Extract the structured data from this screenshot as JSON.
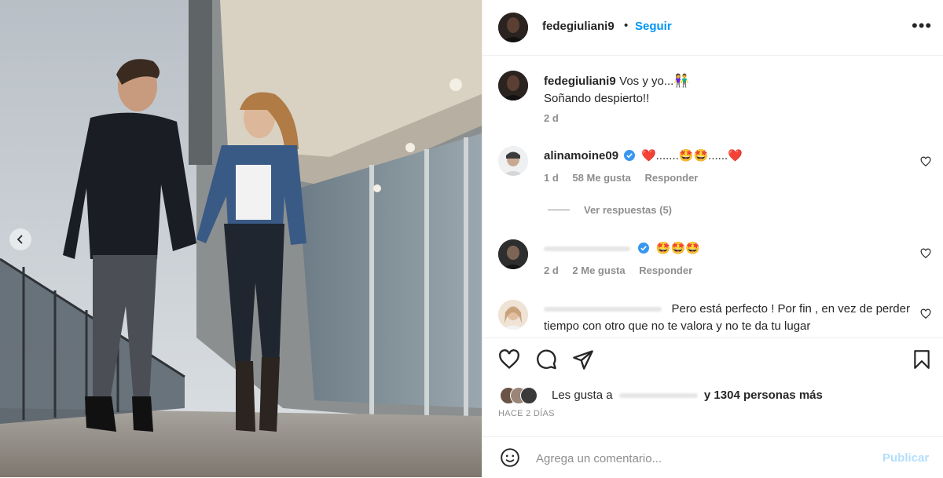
{
  "post": {
    "author": "fedegiuliani9",
    "follow_label": "Seguir",
    "separator": "•",
    "more_label": "•••"
  },
  "caption": {
    "user": "fedegiuliani9",
    "line1": "Vos y yo...",
    "emoji": "👫",
    "line2": "Soñando despierto!!",
    "time": "2 d"
  },
  "comments": [
    {
      "user": "alinamoine09",
      "verified": true,
      "text": "❤️.......🤩🤩......❤️",
      "time": "1 d",
      "likes": "58 Me gusta",
      "reply": "Responder",
      "view_replies": "Ver respuestas (5)"
    },
    {
      "user": "",
      "verified": true,
      "text": "🤩🤩🤩",
      "time": "2 d",
      "likes": "2 Me gusta",
      "reply": "Responder"
    },
    {
      "user": "",
      "text": "Pero está perfecto ! Por fin , en vez de perder tiempo con otro que no te valora y no te da tu lugar"
    }
  ],
  "likes_line": {
    "prefix": "Les gusta a",
    "suffix": "y 1304 personas más"
  },
  "time_ago": "HACE 2 DÍAS",
  "add_comment": {
    "placeholder": "Agrega un comentario...",
    "publish_label": "Publicar"
  },
  "colors": {
    "accent": "#0095f6",
    "muted": "#8e8e8e",
    "publish_disabled": "#b3dffc",
    "verified": "#3897f0"
  }
}
